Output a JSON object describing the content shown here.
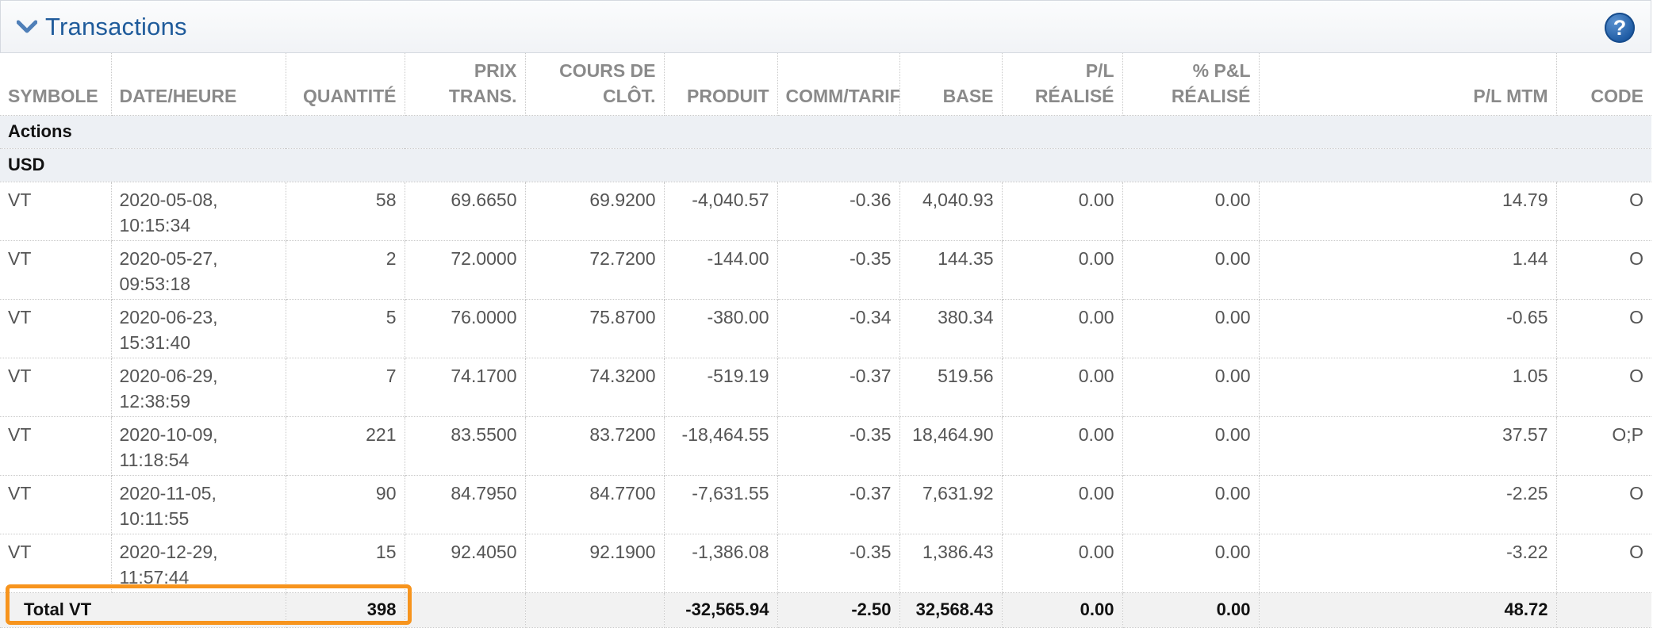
{
  "header": {
    "title": "Transactions",
    "chevron_icon": "chevron-down-icon",
    "help_icon": "help-question-icon",
    "help_label": "?"
  },
  "columns": [
    {
      "key": "symbole",
      "label": "SYMBOLE"
    },
    {
      "key": "date",
      "label": "DATE/HEURE"
    },
    {
      "key": "quantite",
      "label": "QUANTITÉ"
    },
    {
      "key": "prix",
      "label": "PRIX TRANS."
    },
    {
      "key": "cours",
      "label": "COURS DE CLÔT."
    },
    {
      "key": "produit",
      "label": "PRODUIT"
    },
    {
      "key": "comm",
      "label": "COMM/TARIF"
    },
    {
      "key": "base",
      "label": "BASE"
    },
    {
      "key": "pl_realise",
      "label": "P/L RÉALISÉ"
    },
    {
      "key": "pct_pl_realise",
      "label": "% P&L RÉALISÉ"
    },
    {
      "key": "pl_mtm",
      "label": "P/L MTM"
    },
    {
      "key": "code",
      "label": "CODE"
    }
  ],
  "groups": {
    "asset_class": "Actions",
    "currency": "USD"
  },
  "rows": [
    {
      "symbole": "VT",
      "date": "2020-05-08,",
      "time": "10:15:34",
      "quantite": "58",
      "prix": "69.6650",
      "cours": "69.9200",
      "produit": "-4,040.57",
      "comm": "-0.36",
      "base": "4,040.93",
      "pl_realise": "0.00",
      "pct_pl_realise": "0.00",
      "pl_mtm": "14.79",
      "code": "O"
    },
    {
      "symbole": "VT",
      "date": "2020-05-27,",
      "time": "09:53:18",
      "quantite": "2",
      "prix": "72.0000",
      "cours": "72.7200",
      "produit": "-144.00",
      "comm": "-0.35",
      "base": "144.35",
      "pl_realise": "0.00",
      "pct_pl_realise": "0.00",
      "pl_mtm": "1.44",
      "code": "O"
    },
    {
      "symbole": "VT",
      "date": "2020-06-23,",
      "time": "15:31:40",
      "quantite": "5",
      "prix": "76.0000",
      "cours": "75.8700",
      "produit": "-380.00",
      "comm": "-0.34",
      "base": "380.34",
      "pl_realise": "0.00",
      "pct_pl_realise": "0.00",
      "pl_mtm": "-0.65",
      "code": "O"
    },
    {
      "symbole": "VT",
      "date": "2020-06-29,",
      "time": "12:38:59",
      "quantite": "7",
      "prix": "74.1700",
      "cours": "74.3200",
      "produit": "-519.19",
      "comm": "-0.37",
      "base": "519.56",
      "pl_realise": "0.00",
      "pct_pl_realise": "0.00",
      "pl_mtm": "1.05",
      "code": "O"
    },
    {
      "symbole": "VT",
      "date": "2020-10-09,",
      "time": "11:18:54",
      "quantite": "221",
      "prix": "83.5500",
      "cours": "83.7200",
      "produit": "-18,464.55",
      "comm": "-0.35",
      "base": "18,464.90",
      "pl_realise": "0.00",
      "pct_pl_realise": "0.00",
      "pl_mtm": "37.57",
      "code": "O;P"
    },
    {
      "symbole": "VT",
      "date": "2020-11-05,",
      "time": "10:11:55",
      "quantite": "90",
      "prix": "84.7950",
      "cours": "84.7700",
      "produit": "-7,631.55",
      "comm": "-0.37",
      "base": "7,631.92",
      "pl_realise": "0.00",
      "pct_pl_realise": "0.00",
      "pl_mtm": "-2.25",
      "code": "O"
    },
    {
      "symbole": "VT",
      "date": "2020-12-29,",
      "time": "11:57:44",
      "quantite": "15",
      "prix": "92.4050",
      "cours": "92.1900",
      "produit": "-1,386.08",
      "comm": "-0.35",
      "base": "1,386.43",
      "pl_realise": "0.00",
      "pct_pl_realise": "0.00",
      "pl_mtm": "-3.22",
      "code": "O"
    }
  ],
  "total": {
    "label": "Total VT",
    "quantite": "398",
    "produit": "-32,565.94",
    "comm": "-2.50",
    "base": "32,568.43",
    "pl_realise": "0.00",
    "pct_pl_realise": "0.00",
    "pl_mtm": "48.72"
  },
  "colors": {
    "title_blue": "#1f5b9b",
    "highlight_orange": "#f7941d",
    "group_bg": "#edf0f4",
    "total_bg": "#f2f2f2"
  }
}
